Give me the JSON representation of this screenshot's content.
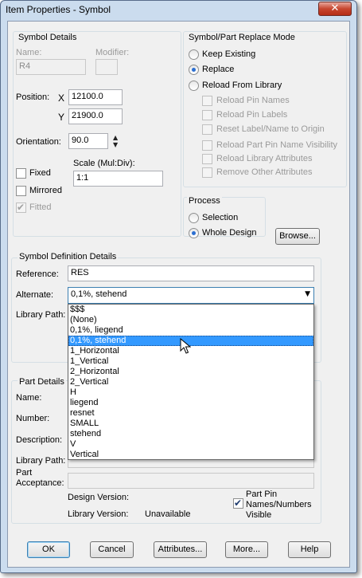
{
  "window": {
    "title": "Item Properties - Symbol",
    "close_glyph": "✕"
  },
  "symbol_details": {
    "legend": "Symbol Details",
    "name_label": "Name:",
    "name_value": "R4",
    "modifier_label": "Modifier:",
    "position_label": "Position:",
    "x_label": "X",
    "x_value": "12100.0",
    "y_label": "Y",
    "y_value": "21900.0",
    "orientation_label": "Orientation:",
    "orientation_value": "90.0",
    "scale_label": "Scale (Mul:Div):",
    "scale_value": "1:1",
    "fixed_label": "Fixed",
    "mirrored_label": "Mirrored",
    "fitted_label": "Fitted"
  },
  "replace_mode": {
    "legend": "Symbol/Part Replace Mode",
    "keep_existing": "Keep Existing",
    "replace": "Replace",
    "reload_from_library": "Reload From Library",
    "selected": "Replace",
    "options": [
      "Reload Pin Names",
      "Reload Pin Labels",
      "Reset Label/Name to Origin",
      "Reload Part Pin Name Visibility",
      "Reload Library Attributes",
      "Remove Other Attributes"
    ]
  },
  "process": {
    "legend": "Process",
    "selection": "Selection",
    "whole_design": "Whole Design",
    "selected": "Whole Design",
    "browse_label": "Browse..."
  },
  "definition": {
    "legend": "Symbol Definition Details",
    "reference_label": "Reference:",
    "reference_value": "RES",
    "alternate_label": "Alternate:",
    "alternate_value": "0,1%, stehend",
    "library_path_label": "Library Path:",
    "alternates": [
      "$$$",
      "(None)",
      "0,1%, liegend",
      "0,1%, stehend",
      "1_Horizontal",
      "1_Vertical",
      "2_Horizontal",
      "2_Vertical",
      "H",
      "liegend",
      "resnet",
      "SMALL",
      "stehend",
      "V",
      "Vertical"
    ],
    "selected_index": 3
  },
  "part_details": {
    "legend": "Part Details",
    "name_label": "Name:",
    "number_label": "Number:",
    "description_label": "Description:",
    "library_path_label": "Library Path:",
    "acceptance_label_1": "Part",
    "acceptance_label_2": "Acceptance:",
    "design_version_label": "Design Version:",
    "library_version_label": "Library Version:",
    "library_version_value": "Unavailable",
    "pin_visible_label_1": "Part Pin",
    "pin_visible_label_2": "Names/Numbers",
    "pin_visible_label_3": "Visible"
  },
  "buttons": {
    "ok": "OK",
    "cancel": "Cancel",
    "attributes": "Attributes...",
    "more": "More...",
    "help": "Help"
  },
  "icons": {
    "spin_up": "▲",
    "spin_down": "▼",
    "dropdown": "▼",
    "check": "✔"
  }
}
